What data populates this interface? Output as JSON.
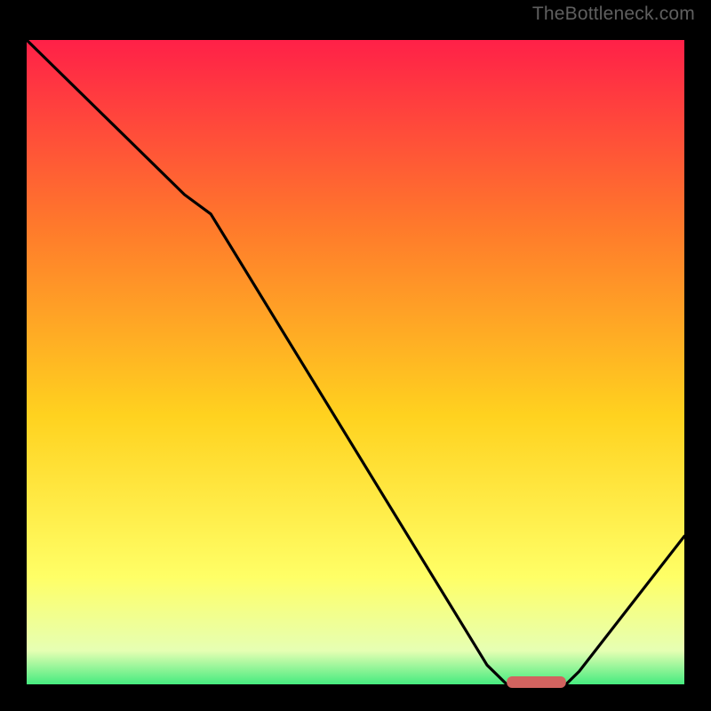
{
  "watermark": "TheBottleneck.com",
  "colors": {
    "gradient_top": "#ff1a4a",
    "gradient_upper_mid": "#ff7a2b",
    "gradient_mid": "#ffd21f",
    "gradient_lower_mid": "#ffff66",
    "gradient_near_bottom": "#e6ffb3",
    "gradient_bottom": "#06e36a",
    "curve": "#000000",
    "marker": "#d1635f",
    "frame_border": "#000000"
  },
  "chart_data": {
    "type": "line",
    "title": "",
    "xlabel": "",
    "ylabel": "",
    "xlim": [
      0,
      100
    ],
    "ylim": [
      0,
      100
    ],
    "series": [
      {
        "name": "bottleneck-curve",
        "x": [
          0,
          24,
          28,
          70,
          73,
          82,
          84,
          100
        ],
        "y": [
          100,
          76,
          73,
          3,
          0,
          0,
          2,
          23
        ]
      }
    ],
    "marker": {
      "name": "optimal-range",
      "x_start": 73,
      "x_end": 82,
      "y": 0
    }
  }
}
